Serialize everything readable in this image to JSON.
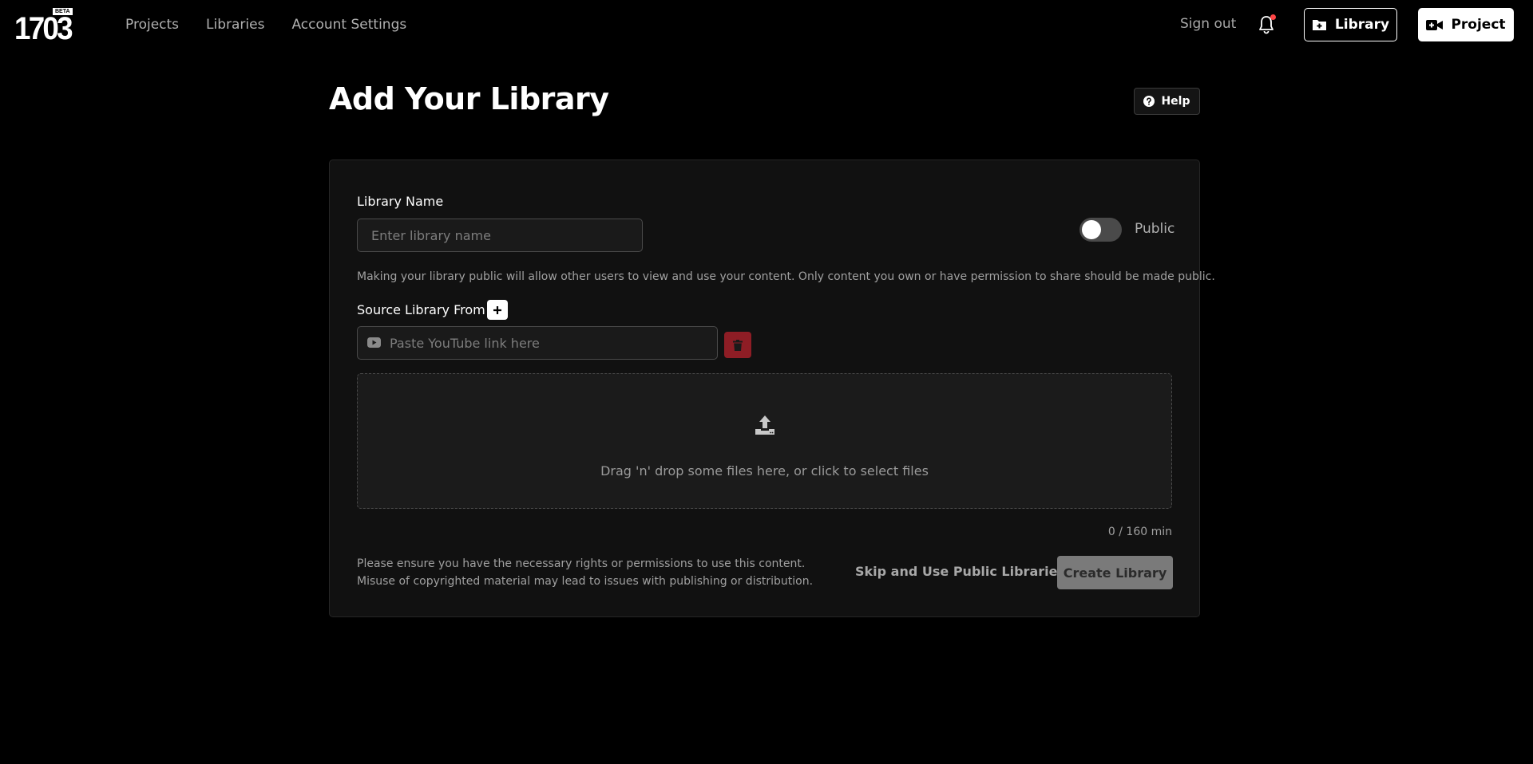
{
  "logo": {
    "text": "1703",
    "badge": "BETA"
  },
  "nav": {
    "items": [
      {
        "label": "Projects"
      },
      {
        "label": "Libraries"
      },
      {
        "label": "Account Settings"
      }
    ]
  },
  "header": {
    "sign_out": "Sign out",
    "library_button": "Library",
    "project_button": "Project",
    "notification_dot_color": "#ff4545"
  },
  "page": {
    "title": "Add Your Library",
    "help_label": "Help"
  },
  "form": {
    "name_label": "Library Name",
    "name_placeholder": "Enter library name",
    "name_value": "",
    "public_label": "Public",
    "public_enabled": false,
    "public_note": "Making your library public will allow other users to view and use your content. Only content you own or have permission to share should be made public.",
    "source_label": "Source Library From",
    "youtube_placeholder": "Paste YouTube link here",
    "youtube_value": "",
    "dropzone_text": "Drag 'n' drop some files here, or click to select files",
    "counter": "0 / 160 min",
    "disclaimer": "Please ensure you have the necessary rights or permissions to use this content. Misuse of copyrighted material may lead to issues with publishing or distribution.",
    "skip_label": "Skip and Use Public Libraries",
    "create_label": "Create Library"
  },
  "colors": {
    "background": "#000000",
    "card": "#111111",
    "danger": "#8e1d25",
    "disabled": "#7a7a7a"
  }
}
